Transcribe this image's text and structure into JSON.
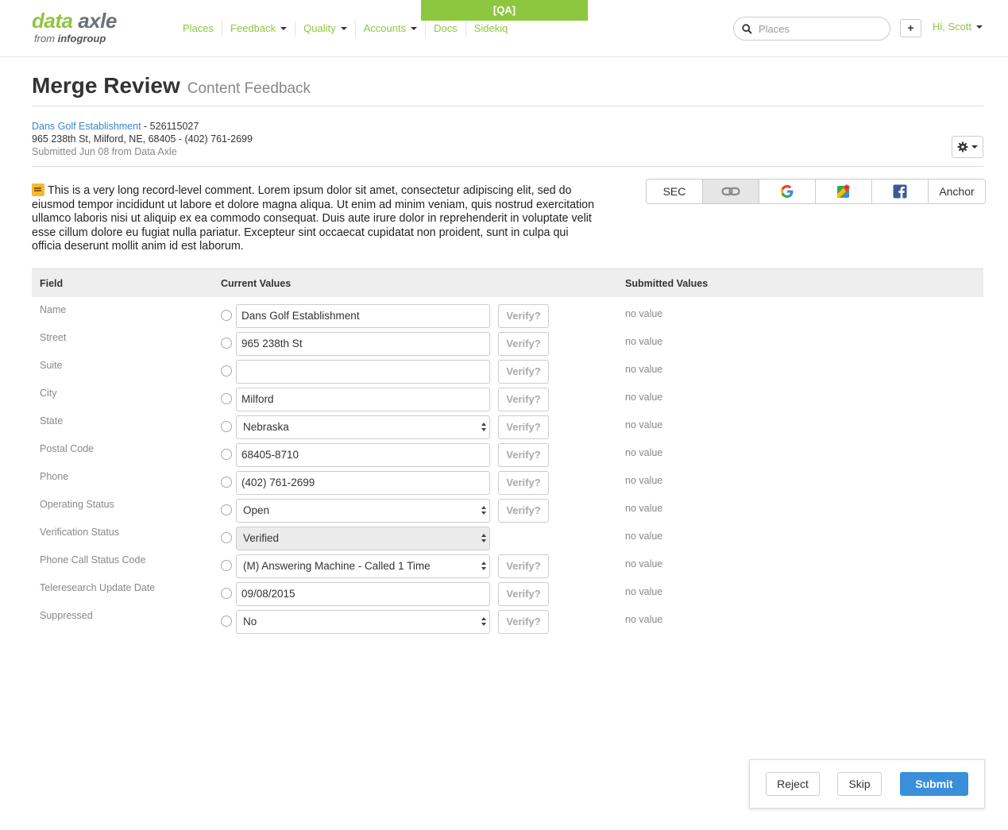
{
  "header": {
    "env_badge": "[QA]",
    "logo_main_part1": "data",
    "logo_main_part2": "axle",
    "logo_from": "from",
    "logo_brand": "infogroup",
    "nav": [
      {
        "label": "Places",
        "dropdown": false
      },
      {
        "label": "Feedback",
        "dropdown": true
      },
      {
        "label": "Quality",
        "dropdown": true
      },
      {
        "label": "Accounts",
        "dropdown": true
      },
      {
        "label": "Docs",
        "dropdown": false
      },
      {
        "label": "Sidekiq",
        "dropdown": false
      }
    ],
    "search_placeholder": "Places",
    "add_label": "+",
    "user_greeting": "Hi, Scott"
  },
  "page": {
    "title": "Merge Review",
    "subtitle": "Content Feedback"
  },
  "record": {
    "name": "Dans Golf Establishment",
    "id": " - 526115027",
    "address": "965 238th St, Milford, NE, 68405 - (402) 761-2699",
    "submitted": "Submitted Jun 08 from Data Axle"
  },
  "comment": "This is a very long record-level comment. Lorem ipsum dolor sit amet, consectetur adipiscing elit, sed do eiusmod tempor incididunt ut labore et dolore magna aliqua. Ut enim ad minim veniam, quis nostrud exercitation ullamco laboris nisi ut aliquip ex ea commodo consequat. Duis aute irure dolor in reprehenderit in voluptate velit esse cillum dolore eu fugiat nulla pariatur. Excepteur sint occaecat cupidatat non proident, sunt in culpa qui officia deserunt mollit anim id est laborum.",
  "sources": [
    {
      "label": "SEC",
      "icon": ""
    },
    {
      "label": "",
      "icon": "link-icon"
    },
    {
      "label": "",
      "icon": "google-icon"
    },
    {
      "label": "",
      "icon": "google-maps-icon"
    },
    {
      "label": "",
      "icon": "facebook-icon"
    },
    {
      "label": "Anchor",
      "icon": ""
    }
  ],
  "table": {
    "headers": {
      "field": "Field",
      "current": "Current Values",
      "submitted": "Submitted Values"
    },
    "rows": [
      {
        "field": "Name",
        "value": "Dans Golf Establishment",
        "type": "text",
        "verify": "Verify?",
        "submitted": "no value"
      },
      {
        "field": "Street",
        "value": "965 238th St",
        "type": "text",
        "verify": "Verify?",
        "submitted": "no value"
      },
      {
        "field": "Suite",
        "value": "",
        "type": "text",
        "verify": "Verify?",
        "submitted": "no value"
      },
      {
        "field": "City",
        "value": "Milford",
        "type": "text",
        "verify": "Verify?",
        "submitted": "no value"
      },
      {
        "field": "State",
        "value": "Nebraska",
        "type": "select",
        "verify": "Verify?",
        "submitted": "no value"
      },
      {
        "field": "Postal Code",
        "value": "68405-8710",
        "type": "text",
        "verify": "Verify?",
        "submitted": "no value"
      },
      {
        "field": "Phone",
        "value": "(402) 761-2699",
        "type": "text",
        "verify": "Verify?",
        "submitted": "no value"
      },
      {
        "field": "Operating Status",
        "value": "Open",
        "type": "select",
        "verify": "Verify?",
        "submitted": "no value"
      },
      {
        "field": "Verification Status",
        "value": "Verified",
        "type": "select-disabled",
        "verify": "",
        "submitted": "no value"
      },
      {
        "field": "Phone Call Status Code",
        "value": "(M) Answering Machine - Called 1 Time",
        "type": "select",
        "verify": "Verify?",
        "submitted": "no value"
      },
      {
        "field": "Teleresearch Update Date",
        "value": "09/08/2015",
        "type": "text",
        "verify": "Verify?",
        "submitted": "no value"
      },
      {
        "field": "Suppressed",
        "value": "No",
        "type": "select",
        "verify": "Verify?",
        "submitted": "no value"
      }
    ]
  },
  "actions": {
    "reject": "Reject",
    "skip": "Skip",
    "submit": "Submit"
  },
  "colors": {
    "brand_green": "#8dc63f",
    "link_blue": "#3a87c8",
    "primary_blue": "#3a8fdb"
  }
}
